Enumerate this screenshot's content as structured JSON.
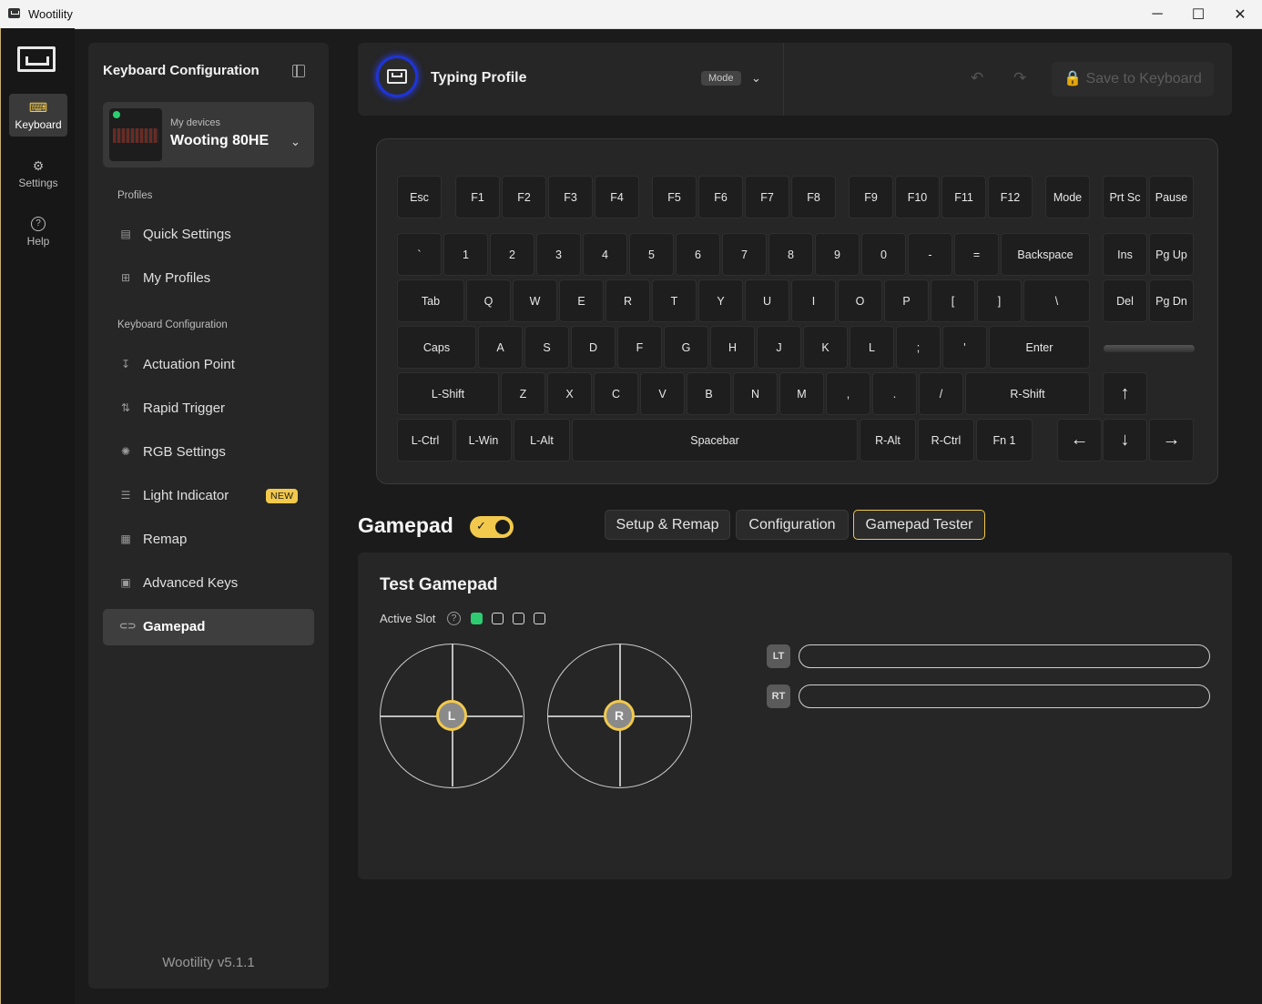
{
  "window": {
    "title": "Wootility",
    "minimize": "─",
    "maximize": "☐",
    "close": "✕"
  },
  "rail": {
    "items": [
      {
        "label": "Keyboard",
        "icon": "keyboard-icon",
        "glyph": "⌨"
      },
      {
        "label": "Settings",
        "icon": "gear-icon",
        "glyph": "⚙"
      },
      {
        "label": "Help",
        "icon": "help-icon",
        "glyph": "?"
      }
    ]
  },
  "sidebar": {
    "title": "Keyboard Configuration",
    "device": {
      "sub": "My devices",
      "name": "Wooting 80HE",
      "status_color": "#2ecc71"
    },
    "profiles_header": "Profiles",
    "profiles": [
      {
        "label": "Quick Settings",
        "icon": "quick-settings-icon",
        "glyph": "▤"
      },
      {
        "label": "My Profiles",
        "icon": "profiles-grid-icon",
        "glyph": "⊞"
      }
    ],
    "config_header": "Keyboard Configuration",
    "config": [
      {
        "label": "Actuation Point",
        "icon": "actuation-icon",
        "glyph": "↧"
      },
      {
        "label": "Rapid Trigger",
        "icon": "rapid-trigger-icon",
        "glyph": "⇅"
      },
      {
        "label": "RGB Settings",
        "icon": "rgb-icon",
        "glyph": "✺"
      },
      {
        "label": "Light Indicator",
        "icon": "light-indicator-icon",
        "glyph": "☰",
        "badge": "NEW"
      },
      {
        "label": "Remap",
        "icon": "remap-icon",
        "glyph": "▦"
      },
      {
        "label": "Advanced Keys",
        "icon": "advanced-keys-icon",
        "glyph": "▣"
      },
      {
        "label": "Gamepad",
        "icon": "gamepad-icon",
        "glyph": "🎮",
        "active": true
      }
    ],
    "version": "Wootility v5.1.1"
  },
  "topbar": {
    "profile_name": "Typing Profile",
    "mode": "Mode",
    "undo": "↶",
    "redo": "↷",
    "save": "🔒 Save to Keyboard"
  },
  "keyboard": {
    "rows": [
      [
        "Esc",
        "F1",
        "F2",
        "F3",
        "F4",
        "F5",
        "F6",
        "F7",
        "F8",
        "F9",
        "F10",
        "F11",
        "F12",
        "Mode",
        "Prt Sc",
        "Pause"
      ],
      [
        "`",
        "1",
        "2",
        "3",
        "4",
        "5",
        "6",
        "7",
        "8",
        "9",
        "0",
        "-",
        "=",
        "Backspace",
        "Ins",
        "Pg Up"
      ],
      [
        "Tab",
        "Q",
        "W",
        "E",
        "R",
        "T",
        "Y",
        "U",
        "I",
        "O",
        "P",
        "[",
        "]",
        "\\",
        "Del",
        "Pg Dn"
      ],
      [
        "Caps",
        "A",
        "S",
        "D",
        "F",
        "G",
        "H",
        "J",
        "K",
        "L",
        ";",
        "'",
        "Enter"
      ],
      [
        "L-Shift",
        "Z",
        "X",
        "C",
        "V",
        "B",
        "N",
        "M",
        ",",
        ".",
        "/",
        "R-Shift",
        "↑"
      ],
      [
        "L-Ctrl",
        "L-Win",
        "L-Alt",
        "Spacebar",
        "R-Alt",
        "R-Ctrl",
        "Fn 1",
        "←",
        "↓",
        "→"
      ]
    ]
  },
  "gamepad": {
    "title": "Gamepad",
    "enabled": true,
    "toggle_check": "✓",
    "tabs": [
      {
        "label": "Setup & Remap"
      },
      {
        "label": "Configuration"
      },
      {
        "label": "Gamepad Tester",
        "active": true
      }
    ],
    "tester": {
      "title": "Test Gamepad",
      "active_slot_label": "Active Slot",
      "help": "?",
      "slots": [
        true,
        false,
        false,
        false
      ],
      "left_stick": "L",
      "right_stick": "R",
      "triggers": [
        {
          "label": "LT",
          "value": 0
        },
        {
          "label": "RT",
          "value": 0
        }
      ]
    }
  }
}
